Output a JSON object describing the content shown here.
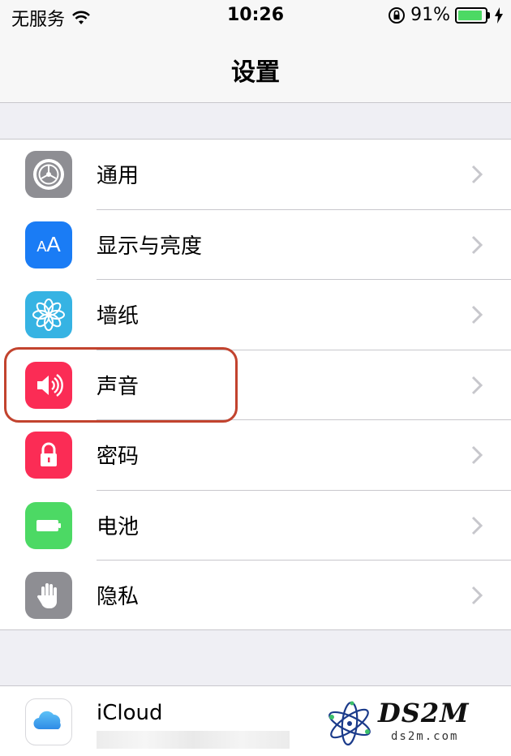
{
  "status_bar": {
    "carrier": "无服务",
    "time": "10:26",
    "battery_percent": "91%",
    "battery_level": 0.91,
    "icons": [
      "wifi-icon",
      "rotation-lock-icon",
      "battery-icon",
      "charging-icon"
    ]
  },
  "nav": {
    "title": "设置"
  },
  "settings": [
    {
      "label": "通用",
      "icon": "gear-icon",
      "color": "#8e8e93"
    },
    {
      "label": "显示与亮度",
      "icon": "text-size-icon",
      "icon_text": "AA",
      "color": "#1a7cf5"
    },
    {
      "label": "墙纸",
      "icon": "flower-icon",
      "color": "#36b3e3"
    },
    {
      "label": "声音",
      "icon": "speaker-icon",
      "color": "#fb2c55",
      "highlighted": true
    },
    {
      "label": "密码",
      "icon": "lock-icon",
      "color": "#fb2c55"
    },
    {
      "label": "电池",
      "icon": "battery-icon",
      "color": "#4cd964"
    },
    {
      "label": "隐私",
      "icon": "hand-icon",
      "color": "#8e8e93"
    }
  ],
  "icloud": {
    "label": "iCloud",
    "icon": "cloud-icon"
  },
  "watermark": {
    "title": "DS2M",
    "url": "ds2m.com"
  },
  "colors": {
    "highlight_border": "#c2432e",
    "chevron": "#c7c7cc"
  }
}
